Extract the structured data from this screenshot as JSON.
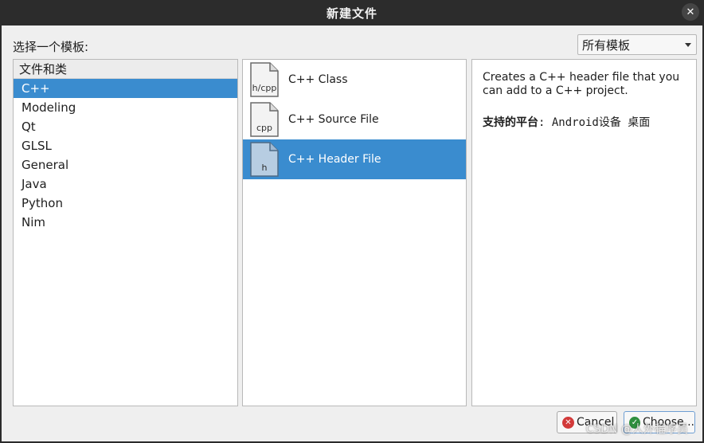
{
  "window": {
    "title": "新建文件"
  },
  "dialog": {
    "choose_label": "选择一个模板:",
    "filter_selected": "所有模板"
  },
  "categories": {
    "header": "文件和类",
    "items": [
      "C++",
      "Modeling",
      "Qt",
      "GLSL",
      "General",
      "Java",
      "Python",
      "Nim"
    ],
    "selected_index": 0
  },
  "templates": {
    "items": [
      {
        "name": "C++ Class",
        "icon_label": "h/cpp"
      },
      {
        "name": "C++ Source File",
        "icon_label": "cpp"
      },
      {
        "name": "C++ Header File",
        "icon_label": "h"
      }
    ],
    "selected_index": 2
  },
  "description": {
    "text": "Creates a C++ header file that you can add to a C++ project.",
    "platforms_label": "支持的平台",
    "platforms_value": ": Android设备 桌面"
  },
  "buttons": {
    "cancel": "Cancel",
    "choose": "Choose..."
  },
  "watermark": "CSDN @人外程序员",
  "colors": {
    "selection": "#3a8ccf",
    "titlebar": "#2c2c2c",
    "dialog_bg": "#efefef"
  },
  "icons": {
    "close": "close-icon",
    "cancel": "cancel-icon",
    "choose": "check-icon",
    "file": "document-icon"
  }
}
